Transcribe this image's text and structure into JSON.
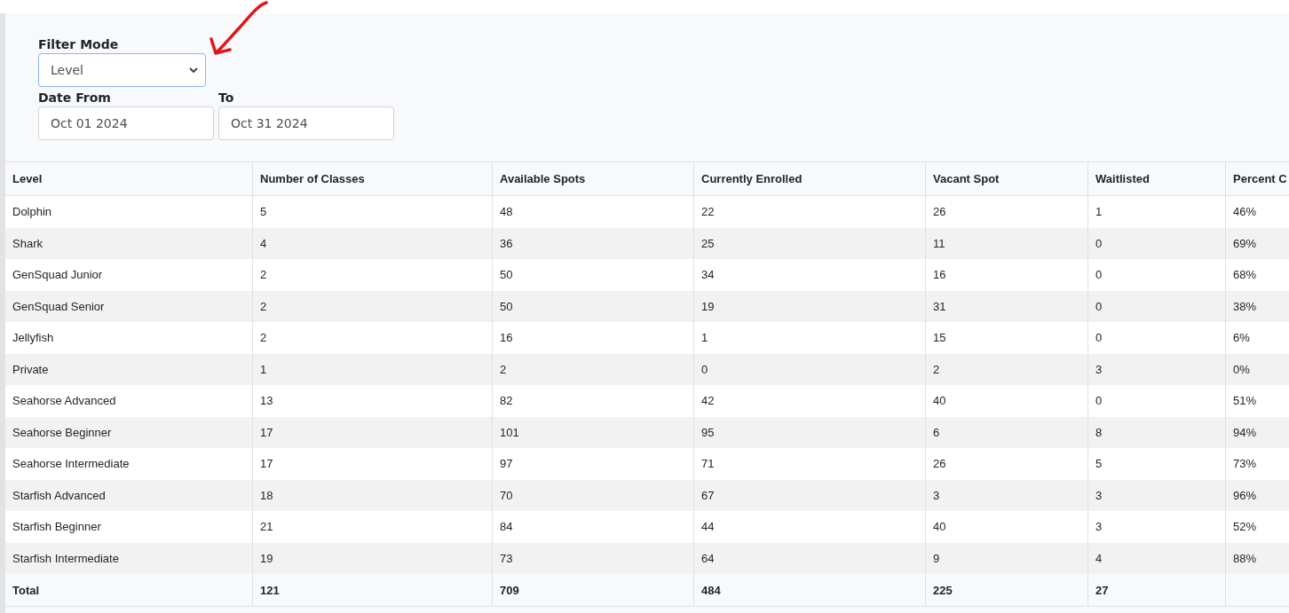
{
  "filters": {
    "filter_mode": {
      "label": "Filter Mode",
      "value": "Level",
      "focused": true
    },
    "date_from": {
      "label": "Date From",
      "value": "Oct 01 2024"
    },
    "date_to": {
      "label": "To",
      "value": "Oct 31 2024"
    }
  },
  "table": {
    "columns": [
      "Level",
      "Number of Classes",
      "Available Spots",
      "Currently Enrolled",
      "Vacant Spot",
      "Waitlisted",
      "Percent C"
    ],
    "rows": [
      [
        "Dolphin",
        "5",
        "48",
        "22",
        "26",
        "1",
        "46%"
      ],
      [
        "Shark",
        "4",
        "36",
        "25",
        "11",
        "0",
        "69%"
      ],
      [
        "GenSquad Junior",
        "2",
        "50",
        "34",
        "16",
        "0",
        "68%"
      ],
      [
        "GenSquad Senior",
        "2",
        "50",
        "19",
        "31",
        "0",
        "38%"
      ],
      [
        "Jellyfish",
        "2",
        "16",
        "1",
        "15",
        "0",
        "6%"
      ],
      [
        "Private",
        "1",
        "2",
        "0",
        "2",
        "3",
        "0%"
      ],
      [
        "Seahorse Advanced",
        "13",
        "82",
        "42",
        "40",
        "0",
        "51%"
      ],
      [
        "Seahorse Beginner",
        "17",
        "101",
        "95",
        "6",
        "8",
        "94%"
      ],
      [
        "Seahorse Intermediate",
        "17",
        "97",
        "71",
        "26",
        "5",
        "73%"
      ],
      [
        "Starfish Advanced",
        "18",
        "70",
        "67",
        "3",
        "3",
        "96%"
      ],
      [
        "Starfish Beginner",
        "21",
        "84",
        "44",
        "40",
        "3",
        "52%"
      ],
      [
        "Starfish Intermediate",
        "19",
        "73",
        "64",
        "9",
        "4",
        "88%"
      ]
    ],
    "total": [
      "Total",
      "121",
      "709",
      "484",
      "225",
      "27"
    ]
  }
}
